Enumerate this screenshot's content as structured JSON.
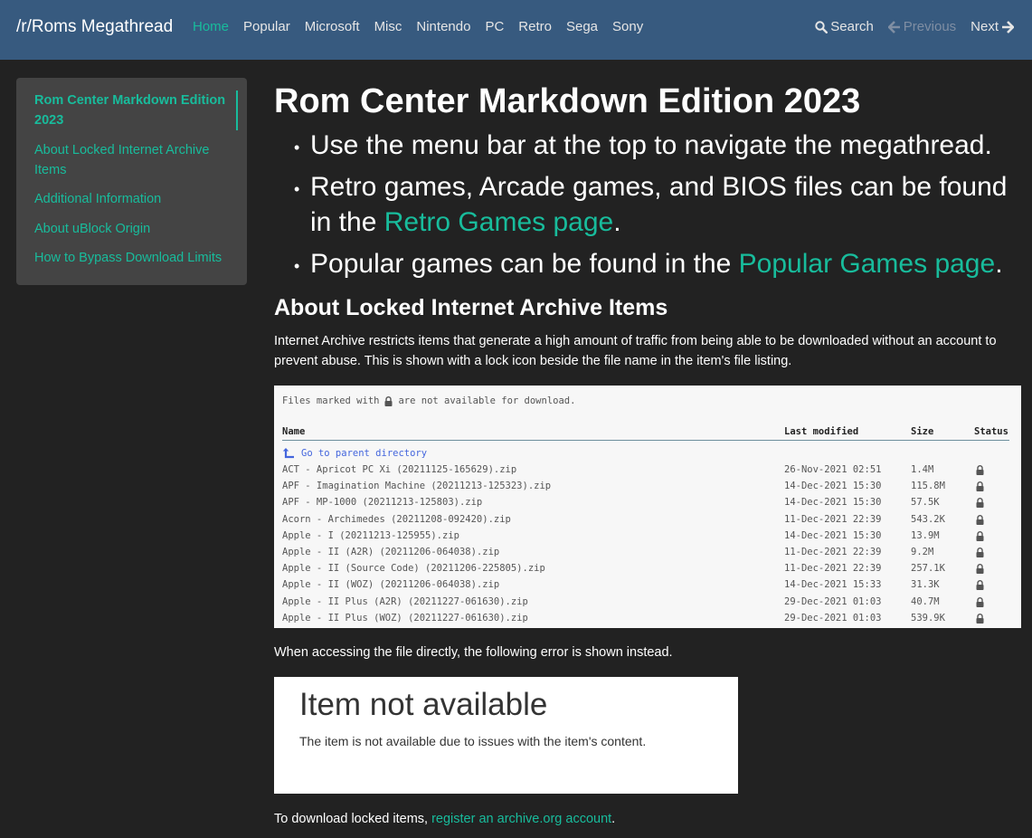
{
  "nav": {
    "brand": "/r/Roms Megathread",
    "links": [
      "Home",
      "Popular",
      "Microsoft",
      "Misc",
      "Nintendo",
      "PC",
      "Retro",
      "Sega",
      "Sony"
    ],
    "active_index": 0,
    "search": "Search",
    "previous": "Previous",
    "next": "Next"
  },
  "sidebar": {
    "items": [
      "Rom Center Markdown Edition 2023",
      "About Locked Internet Archive Items",
      "Additional Information",
      "About uBlock Origin",
      "How to Bypass Download Limits"
    ]
  },
  "main": {
    "title": "Rom Center Markdown Edition 2023",
    "bullet1": "Use the menu bar at the top to navigate the megathread.",
    "bullet2_pre": "Retro games, Arcade games, and BIOS files can be found in the ",
    "bullet2_link": "Retro Games page",
    "bullet2_post": ".",
    "bullet3_pre": "Popular games can be found in the ",
    "bullet3_link": "Popular Games page",
    "bullet3_post": ".",
    "section_title": "About Locked Internet Archive Items",
    "section_text": "Internet Archive restricts items that generate a high amount of traffic from being able to be downloaded without an account to prevent abuse. This is shown with a lock icon beside the file name in the item's file listing.",
    "error_intro": "When accessing the file directly, the following error is shown instead.",
    "download_pre": "To download locked items, ",
    "download_link": "register an archive.org account",
    "download_post": "."
  },
  "archive": {
    "note_pre": "Files marked with",
    "note_post": "are not available for download.",
    "headers": {
      "name": "Name",
      "modified": "Last modified",
      "size": "Size",
      "status": "Status"
    },
    "parent": "Go to parent directory",
    "rows": [
      {
        "name": "ACT - Apricot PC Xi (20211125-165629).zip",
        "modified": "26-Nov-2021 02:51",
        "size": "1.4M"
      },
      {
        "name": "APF - Imagination Machine (20211213-125323).zip",
        "modified": "14-Dec-2021 15:30",
        "size": "115.8M"
      },
      {
        "name": "APF - MP-1000 (20211213-125803).zip",
        "modified": "14-Dec-2021 15:30",
        "size": "57.5K"
      },
      {
        "name": "Acorn - Archimedes (20211208-092420).zip",
        "modified": "11-Dec-2021 22:39",
        "size": "543.2K"
      },
      {
        "name": "Apple - I (20211213-125955).zip",
        "modified": "14-Dec-2021 15:30",
        "size": "13.9M"
      },
      {
        "name": "Apple - II (A2R) (20211206-064038).zip",
        "modified": "11-Dec-2021 22:39",
        "size": "9.2M"
      },
      {
        "name": "Apple - II (Source Code) (20211206-225805).zip",
        "modified": "11-Dec-2021 22:39",
        "size": "257.1K"
      },
      {
        "name": "Apple - II (WOZ) (20211206-064038).zip",
        "modified": "14-Dec-2021 15:33",
        "size": "31.3K"
      },
      {
        "name": "Apple - II Plus (A2R) (20211227-061630).zip",
        "modified": "29-Dec-2021 01:03",
        "size": "40.7M"
      },
      {
        "name": "Apple - II Plus (WOZ) (20211227-061630).zip",
        "modified": "29-Dec-2021 01:03",
        "size": "539.9K"
      }
    ]
  },
  "error_box": {
    "title": "Item not available",
    "text": "The item is not available due to issues with the item's content."
  }
}
